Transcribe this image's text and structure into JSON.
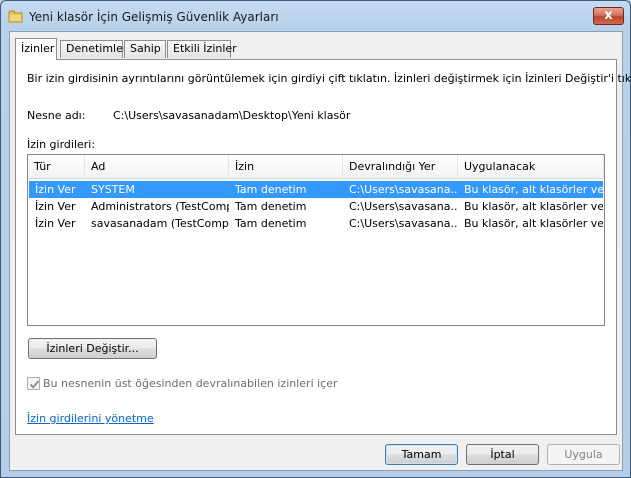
{
  "window": {
    "title": "Yeni klasör İçin Gelişmiş Güvenlik Ayarları",
    "close_glyph": "x"
  },
  "tabs": [
    {
      "label": "İzinler",
      "active": true
    },
    {
      "label": "Denetimler",
      "active": false
    },
    {
      "label": "Sahip",
      "active": false
    },
    {
      "label": "Etkili İzinler",
      "active": false
    }
  ],
  "main": {
    "instruction": "Bir izin girdisinin ayrıntılarını görüntülemek için girdiyi çift tıklatın. İzinleri değiştirmek için İzinleri Değiştir'i tıklatın.",
    "object_name_label": "Nesne adı:",
    "object_name_value": "C:\\Users\\savasanadam\\Desktop\\Yeni klasör",
    "entries_label": "İzin girdileri:"
  },
  "table": {
    "columns": [
      "Tür",
      "Ad",
      "İzin",
      "Devralındığı Yer",
      "Uygulanacak"
    ],
    "rows": [
      [
        "İzin Ver",
        "SYSTEM",
        "Tam denetim",
        "C:\\Users\\savasana...",
        "Bu klasör, alt klasörler ve ..."
      ],
      [
        "İzin Ver",
        "Administrators (TestComp...",
        "Tam denetim",
        "C:\\Users\\savasana...",
        "Bu klasör, alt klasörler ve ..."
      ],
      [
        "İzin Ver",
        "savasanadam (TestComp...",
        "Tam denetim",
        "C:\\Users\\savasana...",
        "Bu klasör, alt klasörler ve ..."
      ]
    ],
    "selected_row": 0
  },
  "change_permissions_label": "İzinleri Değiştir...",
  "inherit_checkbox": {
    "label": "Bu nesnenin üst öğesinden devralınabilen izinleri içer",
    "checked": true,
    "disabled": true
  },
  "manage_link": "İzin girdilerini yönetme",
  "footer": {
    "ok_label": "Tamam",
    "cancel_label": "İptal",
    "apply_label": "Uygula"
  },
  "colors": {
    "selection": "#3399ff",
    "link": "#0066cc",
    "titlebar": "#b9d1ea"
  },
  "icons": {
    "title": "folder-icon",
    "close": "close-icon",
    "checkbox": "checkmark-icon"
  }
}
